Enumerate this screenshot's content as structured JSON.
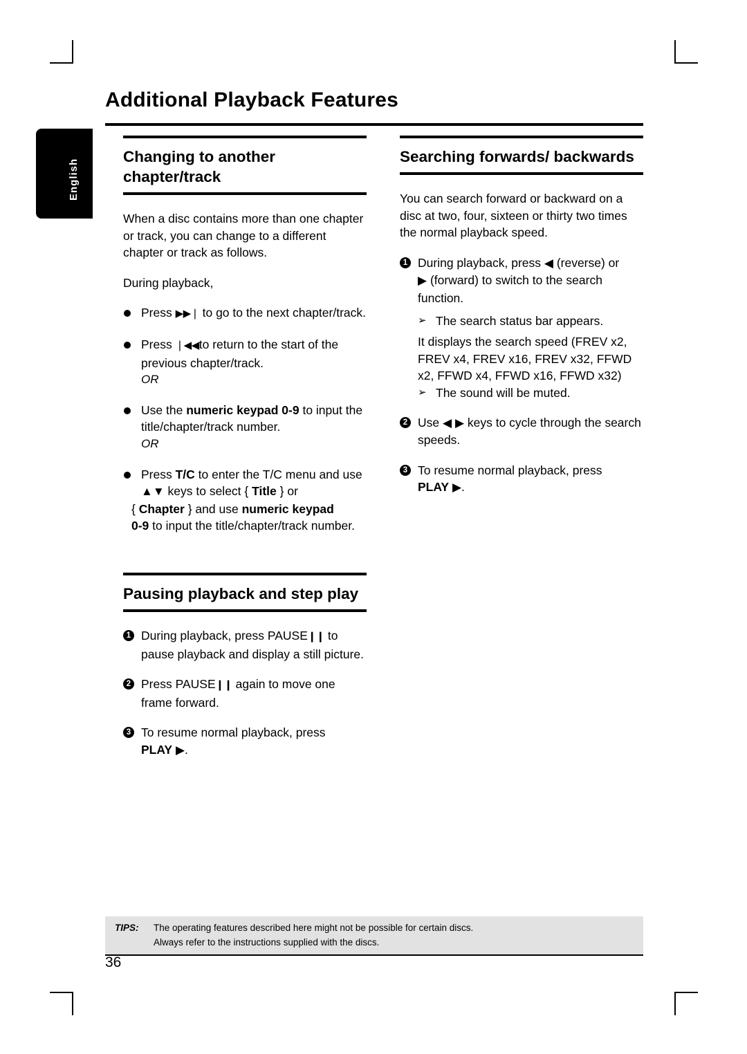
{
  "page": {
    "title": "Additional Playback Features",
    "language_tab": "English",
    "page_number": "36"
  },
  "left_column": {
    "section1": {
      "heading": "Changing to another chapter/track",
      "intro": "When a disc contains more than one chapter or track, you can change to a different chapter or track as follows.",
      "during": "During playback,",
      "bullets": [
        {
          "pre": "Press ",
          "icon": "next-track-icon",
          "glyph": "▶▶❘",
          "post": " to go to the next chapter/track."
        },
        {
          "pre": "Press ",
          "icon": "previous-track-icon",
          "glyph": "❘◀◀",
          "post": "to return to the start of the previous chapter/track."
        },
        {
          "pre": "Use the ",
          "bold": "numeric keypad 0-9",
          "post": " to input the title/chapter/track number."
        },
        {
          "pre": "Press ",
          "bold": "T/C",
          "post": " to enter the T/C menu and use"
        }
      ],
      "or_label": "OR",
      "tc_line2_icons": "▲▼",
      "tc_line2": " keys to select { ",
      "tc_title_bold": "Title",
      "tc_line2_end": " } or",
      "tc_line3_a": "{ ",
      "tc_chapter_bold": "Chapter",
      "tc_line3_b": " } and use ",
      "tc_keypad_bold": "numeric keypad",
      "tc_line4_bold": "0-9",
      "tc_line4": " to input the title/chapter/track number."
    },
    "section2": {
      "heading": "Pausing playback and step play",
      "steps": [
        {
          "num": "1",
          "pre": "During playback, press PAUSE",
          "icon": "pause-icon",
          "glyph": "❙❙",
          "post": " to pause playback and display a still picture."
        },
        {
          "num": "2",
          "pre": "Press PAUSE",
          "icon": "pause-icon",
          "glyph": "❙❙",
          "post": " again to move one frame forward."
        },
        {
          "num": "3",
          "pre": "To resume normal playback, press",
          "bold": "PLAY",
          "icon": "play-icon",
          "glyph": "▶",
          "post": "."
        }
      ]
    }
  },
  "right_column": {
    "section1": {
      "heading": "Searching forwards/ backwards",
      "intro": "You can search forward or backward on a disc at two, four, sixteen or thirty two times the normal playback speed.",
      "step1": {
        "num": "1",
        "a": "During playback, press ",
        "rev_glyph": "◀",
        "b": " (reverse) or",
        "c_glyph": "▶",
        "c": " (forward) to switch to the search function.",
        "arrow1": "The search status bar appears.",
        "speeds_line1": "It displays the search speed (FREV x2,",
        "speeds_line2": "FREV x4, FREV x16, FREV x32, FFWD",
        "speeds_line3": "x2, FFWD x4, FFWD x16, FFWD x32)",
        "arrow2": "The sound will be muted."
      },
      "step2": {
        "num": "2",
        "a": "Use ",
        "left_glyph": "◀",
        "right_glyph": "▶",
        "b": " keys to cycle through the search speeds."
      },
      "step3": {
        "num": "3",
        "a": "To resume normal playback, press",
        "bold": "PLAY",
        "glyph": "▶",
        "post": "."
      }
    }
  },
  "tips": {
    "label": "TIPS:",
    "line1": "The operating features described here might not be possible for certain discs.",
    "line2": "Always refer to the instructions supplied with the discs."
  }
}
